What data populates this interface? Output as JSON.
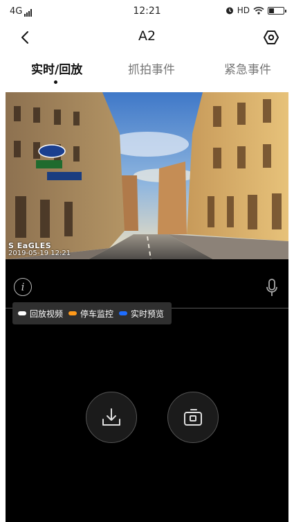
{
  "status_bar": {
    "network": "4G",
    "time": "12:21",
    "hd_label": "HD",
    "battery_level": 0.35,
    "icons": [
      "signal-icon",
      "alarm-icon",
      "wifi-icon",
      "battery-icon"
    ]
  },
  "nav": {
    "title": "A2",
    "back_icon": "chevron-left-icon",
    "settings_icon": "hex-settings-icon"
  },
  "tabs": [
    {
      "label": "实时/回放",
      "active": true
    },
    {
      "label": "抓拍事件",
      "active": false
    },
    {
      "label": "紧急事件",
      "active": false
    }
  ],
  "video": {
    "watermark_brand": "S EaGLES",
    "watermark_datetime": "2019-05-19 12:21"
  },
  "player": {
    "legend": [
      {
        "label": "回放视频",
        "color": "#ffffff"
      },
      {
        "label": "停车监控",
        "color": "#ff9a1a"
      },
      {
        "label": "实时预览",
        "color": "#1e6dff"
      }
    ],
    "info_icon": "info-icon",
    "mic_icon": "microphone-icon",
    "download_icon": "download-icon",
    "snapshot_icon": "camera-icon"
  },
  "colors": {
    "background": "#ffffff",
    "player_background": "#000000",
    "legend_background": "#2f2f2f"
  }
}
